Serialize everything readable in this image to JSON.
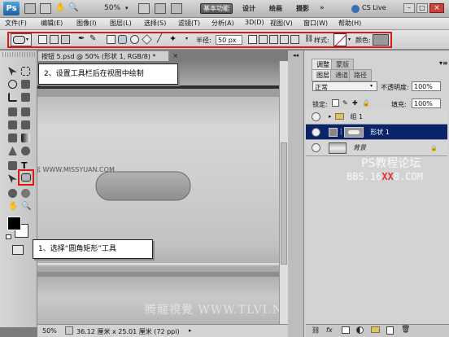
{
  "app": {
    "logo": "Ps",
    "zoom": "50%",
    "workspaces": [
      {
        "label": "基本功能"
      },
      {
        "label": "设计"
      },
      {
        "label": "绘画"
      },
      {
        "label": "摄影"
      }
    ],
    "more": "»",
    "cslive": "CS Live"
  },
  "menu": [
    {
      "label": "文件(F)"
    },
    {
      "label": "编辑(E)"
    },
    {
      "label": "图像(I)"
    },
    {
      "label": "图层(L)"
    },
    {
      "label": "选择(S)"
    },
    {
      "label": "滤镜(T)"
    },
    {
      "label": "分析(A)"
    },
    {
      "label": "3D(D)"
    },
    {
      "label": "视图(V)"
    },
    {
      "label": "窗口(W)"
    },
    {
      "label": "帮助(H)"
    }
  ],
  "options": {
    "radius_label": "半径:",
    "radius_value": "50 px",
    "style_label": "样式:",
    "color_label": "颜色:",
    "color_value": "#999999"
  },
  "doc": {
    "tab_title": "按钮 5.psd @ 50% (形状 1, RGB/8) *",
    "tab_close": "×",
    "zoom": "50%",
    "info": "36.12 厘米 x 25.01 厘米 (72 ppi)"
  },
  "callouts": {
    "step2": "2、设置工具栏后在视图中绘制",
    "step1": "1、选择“圆角矩形”工具"
  },
  "watermarks": {
    "missyuan": "思缘设计论坛 WWW.MISSYUAN.COM",
    "ps_title": "PS教程论坛",
    "ps_url_a": "BBS.16",
    "ps_url_b": "XX",
    "ps_url_c": "8.COM",
    "tlvi": "腾龍視覺 WWW.TLVI.NET"
  },
  "panel": {
    "top_tabs": [
      {
        "label": "调整"
      },
      {
        "label": "蒙版"
      }
    ],
    "tabs": [
      {
        "label": "图层"
      },
      {
        "label": "通道"
      },
      {
        "label": "路径"
      }
    ],
    "blend_mode": "正常",
    "opacity_label": "不透明度:",
    "opacity_value": "100%",
    "lock_label": "锁定:",
    "fill_label": "填充:",
    "fill_value": "100%",
    "layers": [
      {
        "name": "组 1"
      },
      {
        "name": "形状 1"
      },
      {
        "name": "背景"
      }
    ]
  },
  "colors": {
    "selection_blue": "#0a246a",
    "highlight_red": "#e01818",
    "canvas_top": "#8b8b8b"
  }
}
